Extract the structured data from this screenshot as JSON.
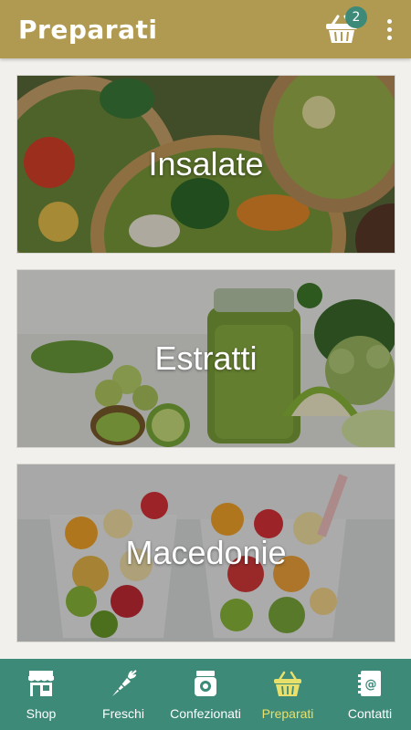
{
  "appbar": {
    "title": "Preparati",
    "cart_count": "2"
  },
  "categories": [
    {
      "label": "Insalate",
      "theme": "salad"
    },
    {
      "label": "Estratti",
      "theme": "juice"
    },
    {
      "label": "Macedonie",
      "theme": "fruit-salad"
    }
  ],
  "bottom_nav": {
    "items": [
      {
        "label": "Shop",
        "icon": "shop-icon"
      },
      {
        "label": "Freschi",
        "icon": "carrot-icon"
      },
      {
        "label": "Confezionati",
        "icon": "jar-icon"
      },
      {
        "label": "Preparati",
        "icon": "basket-icon",
        "active": true
      },
      {
        "label": "Contatti",
        "icon": "contacts-book-icon"
      }
    ]
  },
  "colors": {
    "appbar": "#b09a52",
    "bottom_nav": "#3d8a79",
    "badge": "#3d8a79",
    "active_nav": "#e8e06a",
    "background": "#f1f0ec"
  }
}
